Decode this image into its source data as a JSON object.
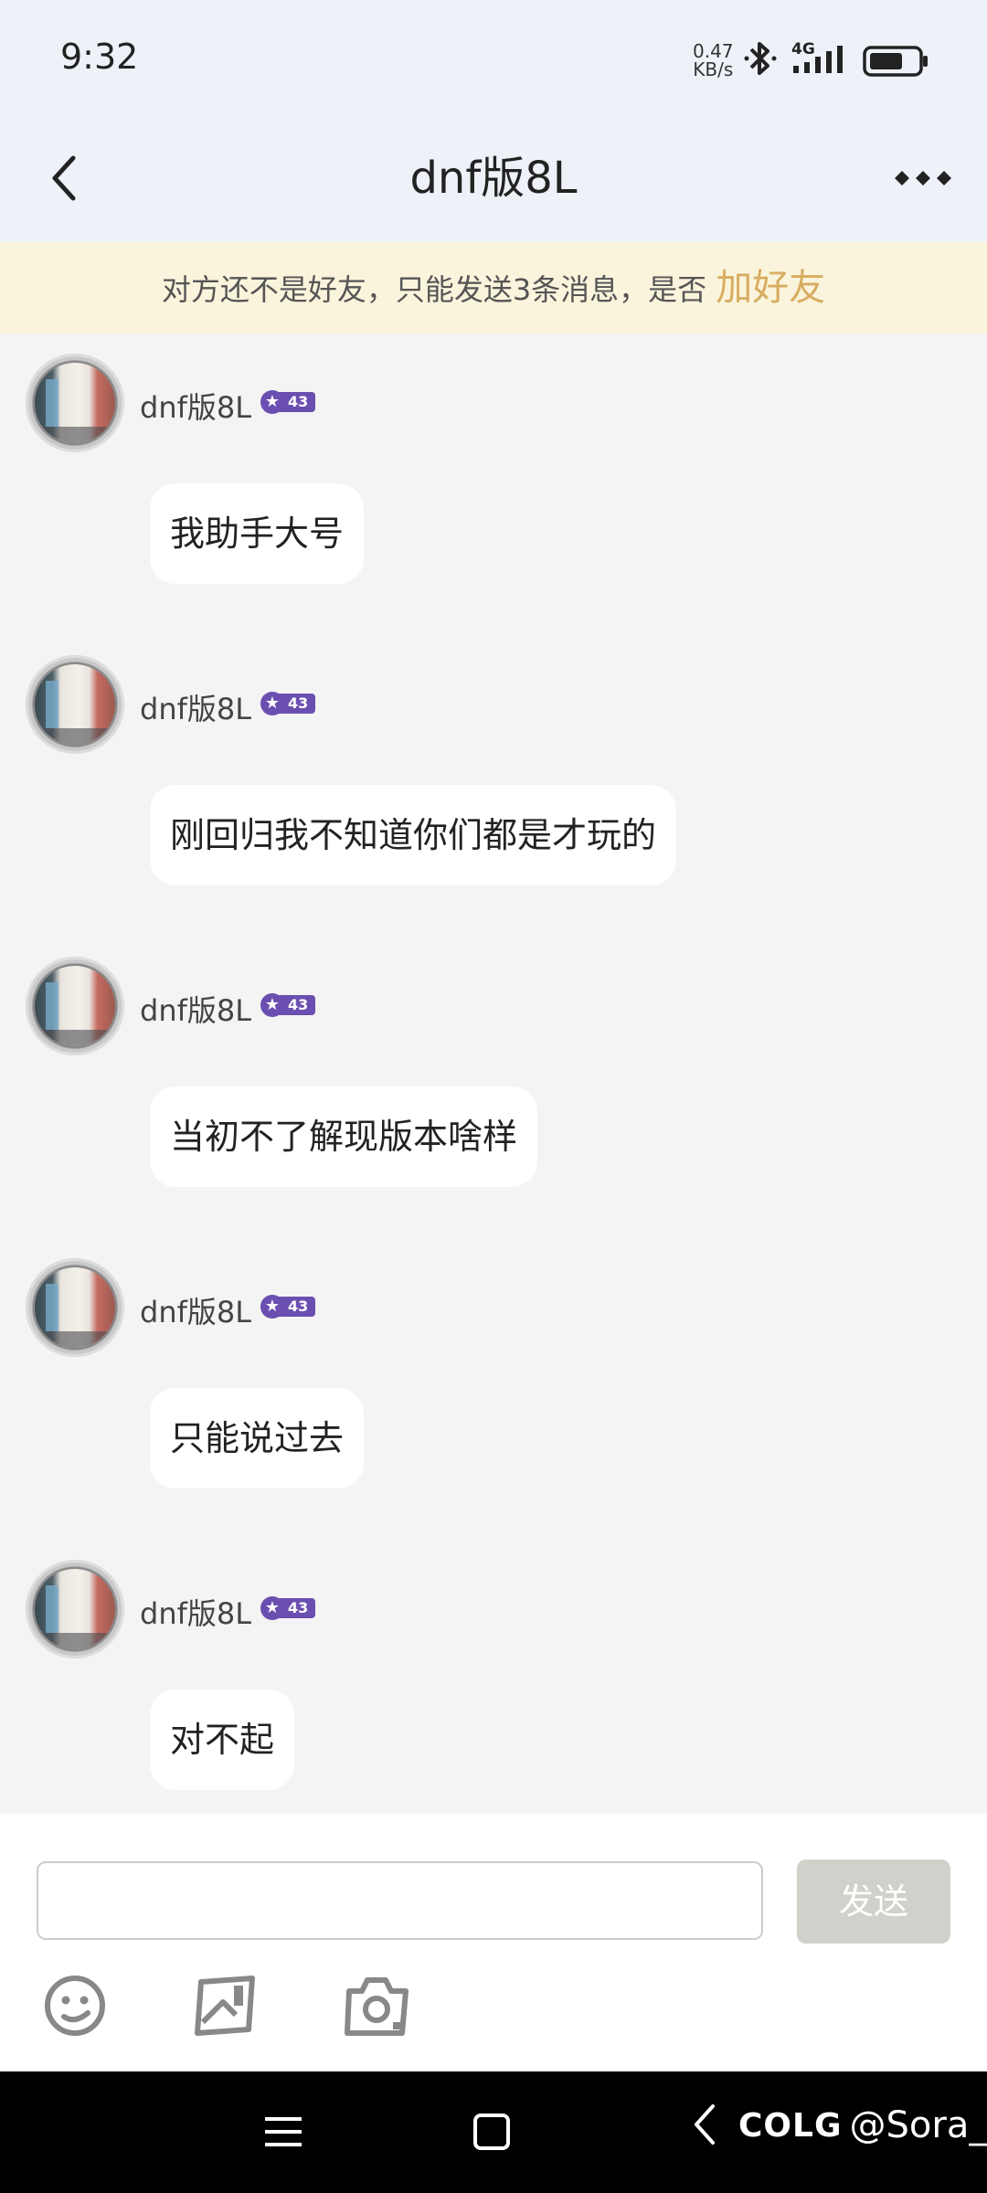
{
  "status_bar": {
    "time": "9:32",
    "net_speed_value": "0.47",
    "net_speed_unit": "KB/s",
    "network": "4G",
    "battery_level": 0.7
  },
  "header": {
    "title": "dnf版8L"
  },
  "notice": {
    "text": "对方还不是好友，只能发送3条消息，是否",
    "link": "加好友"
  },
  "messages": [
    {
      "username": "dnf版8L",
      "level": "43",
      "text": "我助手大号"
    },
    {
      "username": "dnf版8L",
      "level": "43",
      "text": "刚回归我不知道你们都是才玩的"
    },
    {
      "username": "dnf版8L",
      "level": "43",
      "text": "当初不了解现版本啥样"
    },
    {
      "username": "dnf版8L",
      "level": "43",
      "text": "只能说过去"
    },
    {
      "username": "dnf版8L",
      "level": "43",
      "text": "对不起"
    }
  ],
  "composer": {
    "input_value": "",
    "send_label": "发送",
    "tools": [
      "emoji-icon",
      "image-icon",
      "camera-icon"
    ]
  },
  "watermark": {
    "logo": "COLG",
    "handle": "@Sora_"
  },
  "colors": {
    "accent_gold": "#d7ad60",
    "level_badge": "#6a4fb0",
    "notice_bg": "#faf4dc"
  }
}
